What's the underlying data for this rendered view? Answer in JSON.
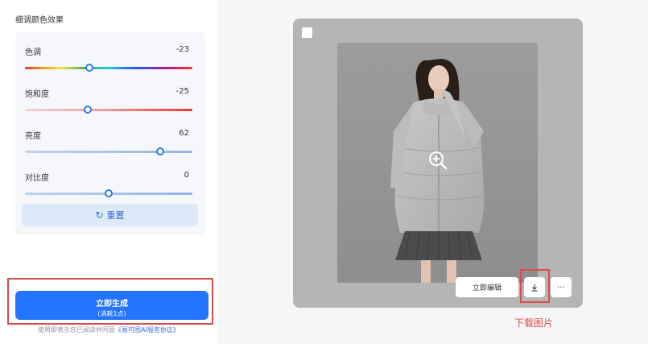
{
  "section_title": "细调颜色效果",
  "sliders": [
    {
      "label": "色调",
      "value": "-23",
      "fraction": 0.385
    },
    {
      "label": "饱和度",
      "value": "-25",
      "fraction": 0.375
    },
    {
      "label": "亮度",
      "value": "62",
      "fraction": 0.81
    },
    {
      "label": "对比度",
      "value": "0",
      "fraction": 0.5
    }
  ],
  "reset_label": "重置",
  "generate": {
    "label": "立即生成",
    "sub": "(消耗1点)"
  },
  "agreement": {
    "text": "使用即表示您已阅读并同意",
    "link": "《易可图AI服务协议》"
  },
  "preview": {
    "edit_label": "立即编辑",
    "more_label": "···"
  },
  "annotation": "下载图片",
  "colors": {
    "accent": "#2374ff",
    "highlight": "#e04a4a"
  }
}
